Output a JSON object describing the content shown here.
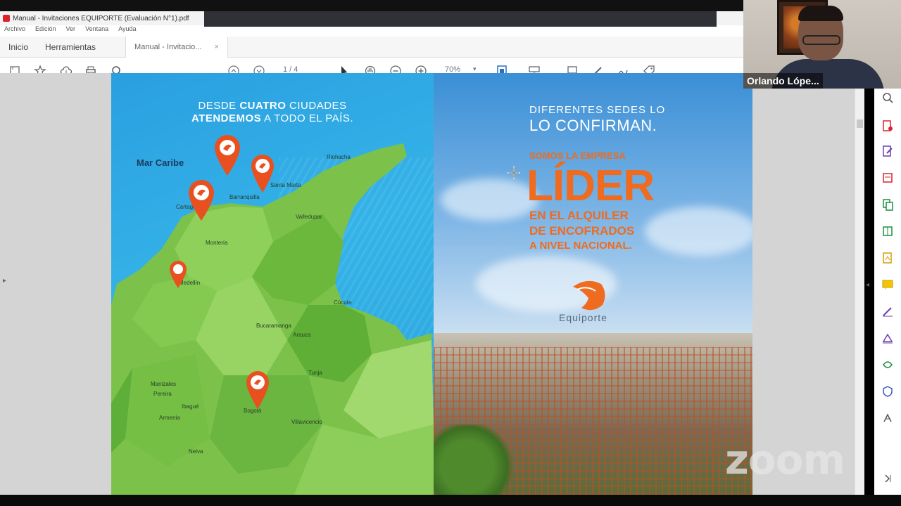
{
  "window": {
    "title": "Manual - Invitaciones EQUIPORTE (Evaluación N°1).pdf",
    "menu": [
      "Archivo",
      "Edición",
      "Ver",
      "Ventana",
      "Ayuda"
    ]
  },
  "tabs": {
    "home": "Inicio",
    "tools": "Herramientas",
    "document": "Manual - Invitacio...",
    "close_symbol": "×"
  },
  "toolbar": {
    "page_indicator": "1 / 4",
    "zoom_level": "70%"
  },
  "page_left": {
    "title_line1_prefix": "DESDE",
    "title_line1_bold": "CUATRO",
    "title_line1_suffix": "CIUDADES",
    "title_line2_bold": "ATENDEMOS",
    "title_line2_suffix": "A TODO EL PAÍS.",
    "sea_label": "Mar Caribe",
    "cities": [
      "Riohacha",
      "Santa Marta",
      "Barranquilla",
      "Cartagena",
      "Valledupar",
      "Montería",
      "Cúcuta",
      "Medellín",
      "Bucaramanga",
      "Arauca",
      "Manizales",
      "Tunja",
      "Bogotá",
      "Pereira",
      "Armenia",
      "Ibagué",
      "Villavicencio",
      "Neiva"
    ]
  },
  "page_right": {
    "line1": "DIFERENTES SEDES LO",
    "line2": "LO CONFIRMAN.",
    "somos": "SOMOS LA EMPRESA",
    "lider": "LÍDER",
    "sub1": "EN EL ALQUILER",
    "sub2": "DE ENCOFRADOS",
    "sub3": "A NIVEL NACIONAL.",
    "brand": "Equiporte"
  },
  "webcam": {
    "participant_name": "Orlando Lópe..."
  },
  "overlay": {
    "zoom_logo": "zoom"
  },
  "colors": {
    "accent_orange": "#ef6b1f",
    "sea_blue": "#2a9fe0",
    "land_green": "#7cc24a"
  }
}
